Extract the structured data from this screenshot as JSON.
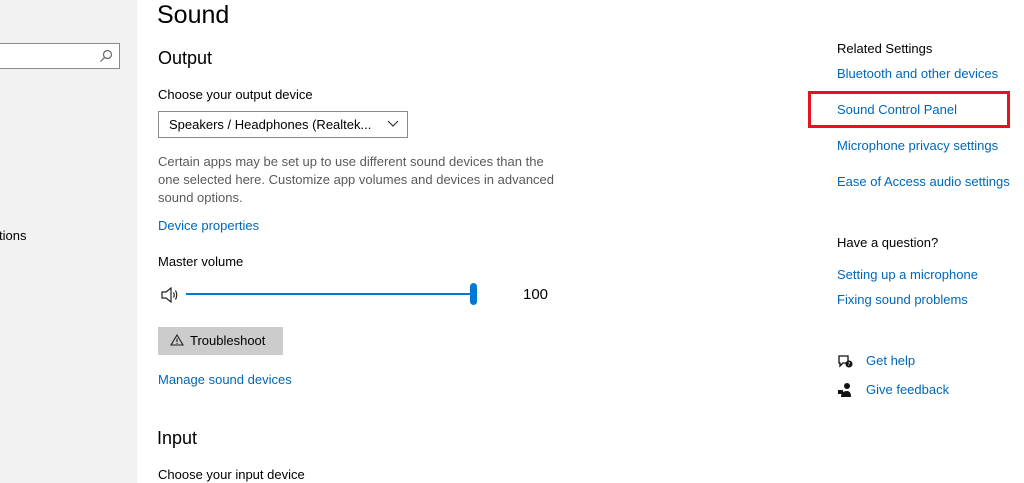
{
  "sidebar": {
    "search": {
      "placeholder": ""
    },
    "partial_item": "tions"
  },
  "main": {
    "title": "Sound",
    "output": {
      "heading": "Output",
      "device_label": "Choose your output device",
      "device_selected": "Speakers / Headphones (Realtek...",
      "description": "Certain apps may be set up to use different sound devices than the one selected here. Customize app volumes and devices in advanced sound options.",
      "device_properties_link": "Device properties",
      "master_volume_label": "Master volume",
      "volume_value": "100",
      "troubleshoot_label": "Troubleshoot",
      "manage_devices_link": "Manage sound devices"
    },
    "input": {
      "heading": "Input",
      "device_label": "Choose your input device"
    }
  },
  "right": {
    "related_heading": "Related Settings",
    "related_links": [
      "Bluetooth and other devices",
      "Sound Control Panel",
      "Microphone privacy settings",
      "Ease of Access audio settings"
    ],
    "question_heading": "Have a question?",
    "question_links": [
      "Setting up a microphone",
      "Fixing sound problems"
    ],
    "get_help": "Get help",
    "give_feedback": "Give feedback"
  },
  "colors": {
    "accent": "#0078d7",
    "link": "#0067b8",
    "highlight": "#e8121f"
  }
}
